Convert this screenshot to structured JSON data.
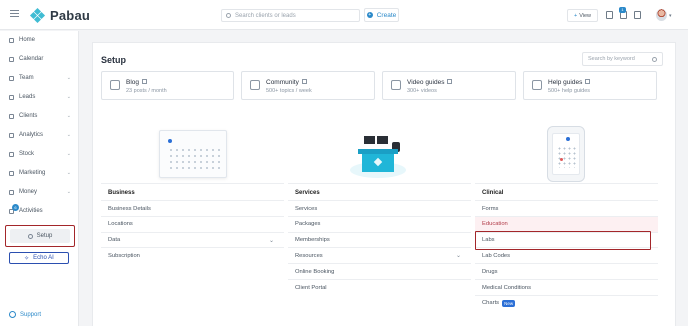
{
  "topbar": {
    "brand": "Pabau",
    "search_placeholder": "Search clients or leads",
    "create_label": "Create",
    "view_label": "View",
    "notification_count": "1"
  },
  "sidebar": {
    "items": [
      {
        "label": "Home",
        "has_chevron": false
      },
      {
        "label": "Calendar",
        "has_chevron": false
      },
      {
        "label": "Team",
        "has_chevron": true
      },
      {
        "label": "Leads",
        "has_chevron": true
      },
      {
        "label": "Clients",
        "has_chevron": true
      },
      {
        "label": "Analytics",
        "has_chevron": true
      },
      {
        "label": "Stock",
        "has_chevron": true
      },
      {
        "label": "Marketing",
        "has_chevron": true
      },
      {
        "label": "Money",
        "has_chevron": true
      },
      {
        "label": "Activities",
        "has_chevron": false
      }
    ],
    "activities_badge": "6",
    "setup_label": "Setup",
    "echo_label": "Echo AI",
    "support_label": "Support"
  },
  "main": {
    "title": "Setup",
    "keyword_placeholder": "Search by keyword",
    "resources": [
      {
        "title": "Blog",
        "subtitle": "23 posts / month"
      },
      {
        "title": "Community",
        "subtitle": "500+ topics / week"
      },
      {
        "title": "Video guides",
        "subtitle": "300+ videos"
      },
      {
        "title": "Help guides",
        "subtitle": "500+ help guides"
      }
    ],
    "columns": [
      {
        "heading": "Business",
        "items": [
          "Business Details",
          "Locations",
          "Data",
          "Subscription"
        ]
      },
      {
        "heading": "Services",
        "items": [
          "Services",
          "Packages",
          "Memberships",
          "Resources",
          "Online Booking",
          "Client Portal"
        ]
      },
      {
        "heading": "Clinical",
        "items": [
          "Forms",
          "Education",
          "Labs",
          "Lab Codes",
          "Drugs",
          "Medical Conditions",
          "Charts"
        ],
        "new_badge": "New"
      }
    ]
  },
  "colors": {
    "accent": "#2b89c9",
    "highlight": "#a3262a",
    "brand": "#3fbcd3"
  }
}
